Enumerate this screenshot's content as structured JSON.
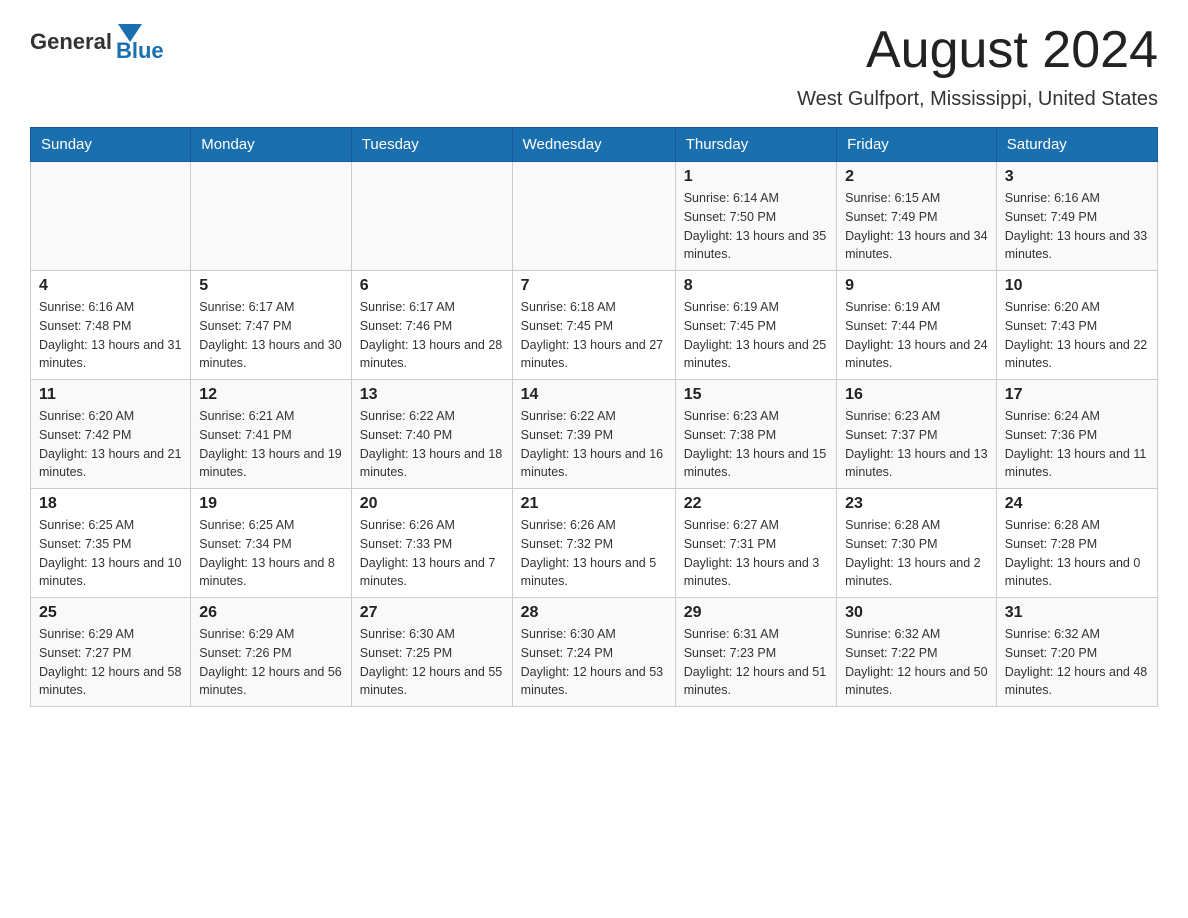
{
  "logo": {
    "general": "General",
    "blue": "Blue"
  },
  "title": "August 2024",
  "location": "West Gulfport, Mississippi, United States",
  "headers": [
    "Sunday",
    "Monday",
    "Tuesday",
    "Wednesday",
    "Thursday",
    "Friday",
    "Saturday"
  ],
  "weeks": [
    [
      {
        "day": "",
        "info": ""
      },
      {
        "day": "",
        "info": ""
      },
      {
        "day": "",
        "info": ""
      },
      {
        "day": "",
        "info": ""
      },
      {
        "day": "1",
        "info": "Sunrise: 6:14 AM\nSunset: 7:50 PM\nDaylight: 13 hours and 35 minutes."
      },
      {
        "day": "2",
        "info": "Sunrise: 6:15 AM\nSunset: 7:49 PM\nDaylight: 13 hours and 34 minutes."
      },
      {
        "day": "3",
        "info": "Sunrise: 6:16 AM\nSunset: 7:49 PM\nDaylight: 13 hours and 33 minutes."
      }
    ],
    [
      {
        "day": "4",
        "info": "Sunrise: 6:16 AM\nSunset: 7:48 PM\nDaylight: 13 hours and 31 minutes."
      },
      {
        "day": "5",
        "info": "Sunrise: 6:17 AM\nSunset: 7:47 PM\nDaylight: 13 hours and 30 minutes."
      },
      {
        "day": "6",
        "info": "Sunrise: 6:17 AM\nSunset: 7:46 PM\nDaylight: 13 hours and 28 minutes."
      },
      {
        "day": "7",
        "info": "Sunrise: 6:18 AM\nSunset: 7:45 PM\nDaylight: 13 hours and 27 minutes."
      },
      {
        "day": "8",
        "info": "Sunrise: 6:19 AM\nSunset: 7:45 PM\nDaylight: 13 hours and 25 minutes."
      },
      {
        "day": "9",
        "info": "Sunrise: 6:19 AM\nSunset: 7:44 PM\nDaylight: 13 hours and 24 minutes."
      },
      {
        "day": "10",
        "info": "Sunrise: 6:20 AM\nSunset: 7:43 PM\nDaylight: 13 hours and 22 minutes."
      }
    ],
    [
      {
        "day": "11",
        "info": "Sunrise: 6:20 AM\nSunset: 7:42 PM\nDaylight: 13 hours and 21 minutes."
      },
      {
        "day": "12",
        "info": "Sunrise: 6:21 AM\nSunset: 7:41 PM\nDaylight: 13 hours and 19 minutes."
      },
      {
        "day": "13",
        "info": "Sunrise: 6:22 AM\nSunset: 7:40 PM\nDaylight: 13 hours and 18 minutes."
      },
      {
        "day": "14",
        "info": "Sunrise: 6:22 AM\nSunset: 7:39 PM\nDaylight: 13 hours and 16 minutes."
      },
      {
        "day": "15",
        "info": "Sunrise: 6:23 AM\nSunset: 7:38 PM\nDaylight: 13 hours and 15 minutes."
      },
      {
        "day": "16",
        "info": "Sunrise: 6:23 AM\nSunset: 7:37 PM\nDaylight: 13 hours and 13 minutes."
      },
      {
        "day": "17",
        "info": "Sunrise: 6:24 AM\nSunset: 7:36 PM\nDaylight: 13 hours and 11 minutes."
      }
    ],
    [
      {
        "day": "18",
        "info": "Sunrise: 6:25 AM\nSunset: 7:35 PM\nDaylight: 13 hours and 10 minutes."
      },
      {
        "day": "19",
        "info": "Sunrise: 6:25 AM\nSunset: 7:34 PM\nDaylight: 13 hours and 8 minutes."
      },
      {
        "day": "20",
        "info": "Sunrise: 6:26 AM\nSunset: 7:33 PM\nDaylight: 13 hours and 7 minutes."
      },
      {
        "day": "21",
        "info": "Sunrise: 6:26 AM\nSunset: 7:32 PM\nDaylight: 13 hours and 5 minutes."
      },
      {
        "day": "22",
        "info": "Sunrise: 6:27 AM\nSunset: 7:31 PM\nDaylight: 13 hours and 3 minutes."
      },
      {
        "day": "23",
        "info": "Sunrise: 6:28 AM\nSunset: 7:30 PM\nDaylight: 13 hours and 2 minutes."
      },
      {
        "day": "24",
        "info": "Sunrise: 6:28 AM\nSunset: 7:28 PM\nDaylight: 13 hours and 0 minutes."
      }
    ],
    [
      {
        "day": "25",
        "info": "Sunrise: 6:29 AM\nSunset: 7:27 PM\nDaylight: 12 hours and 58 minutes."
      },
      {
        "day": "26",
        "info": "Sunrise: 6:29 AM\nSunset: 7:26 PM\nDaylight: 12 hours and 56 minutes."
      },
      {
        "day": "27",
        "info": "Sunrise: 6:30 AM\nSunset: 7:25 PM\nDaylight: 12 hours and 55 minutes."
      },
      {
        "day": "28",
        "info": "Sunrise: 6:30 AM\nSunset: 7:24 PM\nDaylight: 12 hours and 53 minutes."
      },
      {
        "day": "29",
        "info": "Sunrise: 6:31 AM\nSunset: 7:23 PM\nDaylight: 12 hours and 51 minutes."
      },
      {
        "day": "30",
        "info": "Sunrise: 6:32 AM\nSunset: 7:22 PM\nDaylight: 12 hours and 50 minutes."
      },
      {
        "day": "31",
        "info": "Sunrise: 6:32 AM\nSunset: 7:20 PM\nDaylight: 12 hours and 48 minutes."
      }
    ]
  ]
}
